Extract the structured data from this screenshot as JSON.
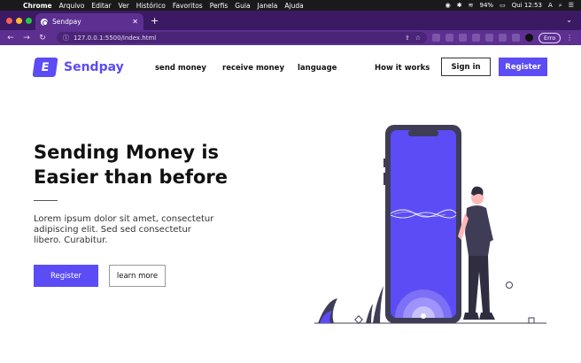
{
  "menubar": {
    "app": "Chrome",
    "items": [
      "Arquivo",
      "Editar",
      "Ver",
      "Histórico",
      "Favoritos",
      "Perfis",
      "Guia",
      "Janela",
      "Ajuda"
    ],
    "battery": "94%",
    "clock": "Qui 12:53"
  },
  "browser": {
    "tab_title": "Sendpay",
    "url": "127.0.0.1:5500/index.html",
    "profile_badge": "Erro"
  },
  "site": {
    "brand": "Sendpay",
    "logo_letter": "E",
    "nav": [
      "send money",
      "receive money",
      "language",
      "How it works"
    ],
    "signin_label": "Sign in",
    "register_label": "Register",
    "hero_title_line1": "Sending Money is",
    "hero_title_line2": "Easier than before",
    "hero_text": "Lorem ipsum dolor sit amet, consectetur adipiscing elit. Sed sed consectetur libero. Curabitur.",
    "hero_register_label": "Register",
    "learn_more_label": "learn more",
    "accent_color": "#5b4cf5"
  }
}
